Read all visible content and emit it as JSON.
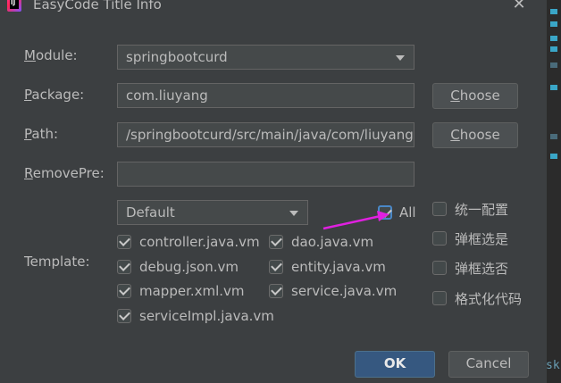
{
  "window": {
    "title": "EasyCode Title Info",
    "close_glyph": "✕"
  },
  "form": {
    "module": {
      "label_u": "M",
      "label_rest": "odule:",
      "value": "springbootcurd"
    },
    "package": {
      "label_u": "P",
      "label_rest": "ackage:",
      "value": "com.liuyang",
      "choose_u": "C",
      "choose_rest": "hoose"
    },
    "path": {
      "label_u": "P",
      "label_rest": "ath:",
      "value": "/springbootcurd/src/main/java/com/liuyang",
      "choose_u": "C",
      "choose_rest": "hoose"
    },
    "remove_pre": {
      "label_u": "R",
      "label_rest": "emovePre:",
      "value": ""
    },
    "template": {
      "label": "Template:",
      "group_value": "Default",
      "all_label": "All",
      "items": [
        {
          "label": "controller.java.vm",
          "checked": true
        },
        {
          "label": "dao.java.vm",
          "checked": true
        },
        {
          "label": "debug.json.vm",
          "checked": true
        },
        {
          "label": "entity.java.vm",
          "checked": true
        },
        {
          "label": "mapper.xml.vm",
          "checked": true
        },
        {
          "label": "service.java.vm",
          "checked": true
        },
        {
          "label": "serviceImpl.java.vm",
          "checked": true
        }
      ]
    },
    "options": [
      {
        "label": "统一配置",
        "checked": false
      },
      {
        "label": "弹框选是",
        "checked": false
      },
      {
        "label": "弹框选否",
        "checked": false
      },
      {
        "label": "格式化代码",
        "checked": false
      }
    ]
  },
  "buttons": {
    "ok": "OK",
    "cancel": "Cancel"
  },
  "side_text": "sk",
  "colors": {
    "background": "#3c3f41",
    "field": "#45494a",
    "primary": "#365880",
    "annotation_arrow": "#e020e0"
  }
}
